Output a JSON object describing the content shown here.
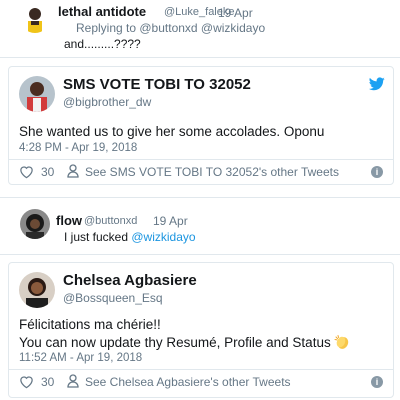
{
  "reply1": {
    "name": "lethal antidote",
    "handle": "@Luke_faleke",
    "time": "19 Apr",
    "replying_to": "Replying to @buttonxd @wizkidayo",
    "text": "and.........????"
  },
  "card1": {
    "name": "SMS VOTE TOBI TO 32052",
    "handle": "@bigbrother_dw",
    "text": "She wanted us to give her some accolades. Oponu",
    "timestamp": "4:28 PM - Apr 19, 2018",
    "likes": "30",
    "see_more": "See SMS VOTE TOBI TO 32052's other Tweets",
    "info_glyph": "i"
  },
  "reply2": {
    "name": "flow",
    "handle": "@buttonxd",
    "time": "19 Apr",
    "text_prefix": "I just fucked ",
    "text_mention": "@wizkidayo"
  },
  "card2": {
    "name": "Chelsea Agbasiere",
    "handle": "@Bossqueen_Esq",
    "line1": "Félicitations ma chérie!!",
    "line2": "You can now update thy Resumé, Profile and Status",
    "emoji": "clapping-hands-emoji",
    "timestamp": "11:52 AM - Apr 19, 2018",
    "likes": "30",
    "see_more": "See Chelsea Agbasiere's other Tweets",
    "info_glyph": "i"
  },
  "colors": {
    "link": "#1b95e0",
    "twitter_blue": "#1da1f2",
    "muted": "#657786",
    "border": "#e1e8ed"
  }
}
